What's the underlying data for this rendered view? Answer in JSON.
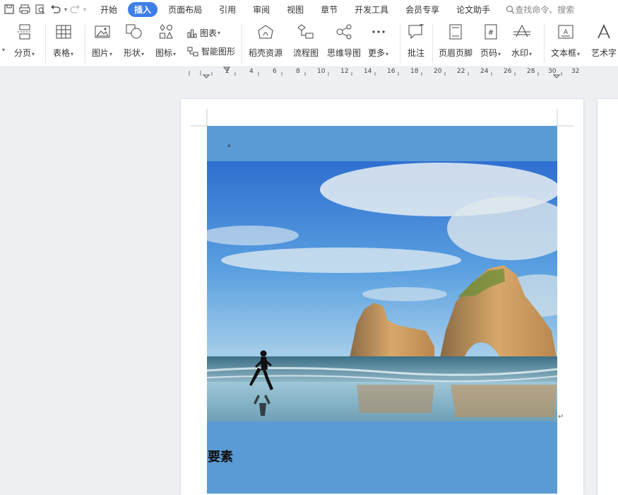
{
  "tabs": [
    {
      "label": "开始"
    },
    {
      "label": "插入"
    },
    {
      "label": "页面布局"
    },
    {
      "label": "引用"
    },
    {
      "label": "审阅"
    },
    {
      "label": "视图"
    },
    {
      "label": "章节"
    },
    {
      "label": "开发工具"
    },
    {
      "label": "会员专享"
    },
    {
      "label": "论文助手"
    }
  ],
  "active_tab": "插入",
  "search": {
    "placeholder": "查找命令、搜索"
  },
  "ribbon": {
    "page_break": "分页",
    "table": "表格",
    "picture": "图片",
    "shape": "形状",
    "icon": "图标",
    "chart": "图表",
    "smart_art": "智能图形",
    "docer": "稻壳资源",
    "flowchart": "流程图",
    "mindmap": "思维导图",
    "more": "更多",
    "comment": "批注",
    "header_footer": "页眉页脚",
    "page_number": "页码",
    "watermark": "水印",
    "textbox": "文本框",
    "wordart": "艺术字"
  },
  "ruler": {
    "numbers": [
      "2",
      "4",
      "6",
      "8",
      "10",
      "12",
      "14",
      "16",
      "18",
      "20",
      "22",
      "24",
      "26",
      "28",
      "30",
      "32"
    ]
  },
  "document": {
    "first_line": "。",
    "heading": "要素",
    "return_mark": "↵"
  },
  "colors": {
    "accent": "#3d7ee8",
    "content_block": "#5b9bd5",
    "page": "#ffffff",
    "background": "#eef0f3"
  }
}
